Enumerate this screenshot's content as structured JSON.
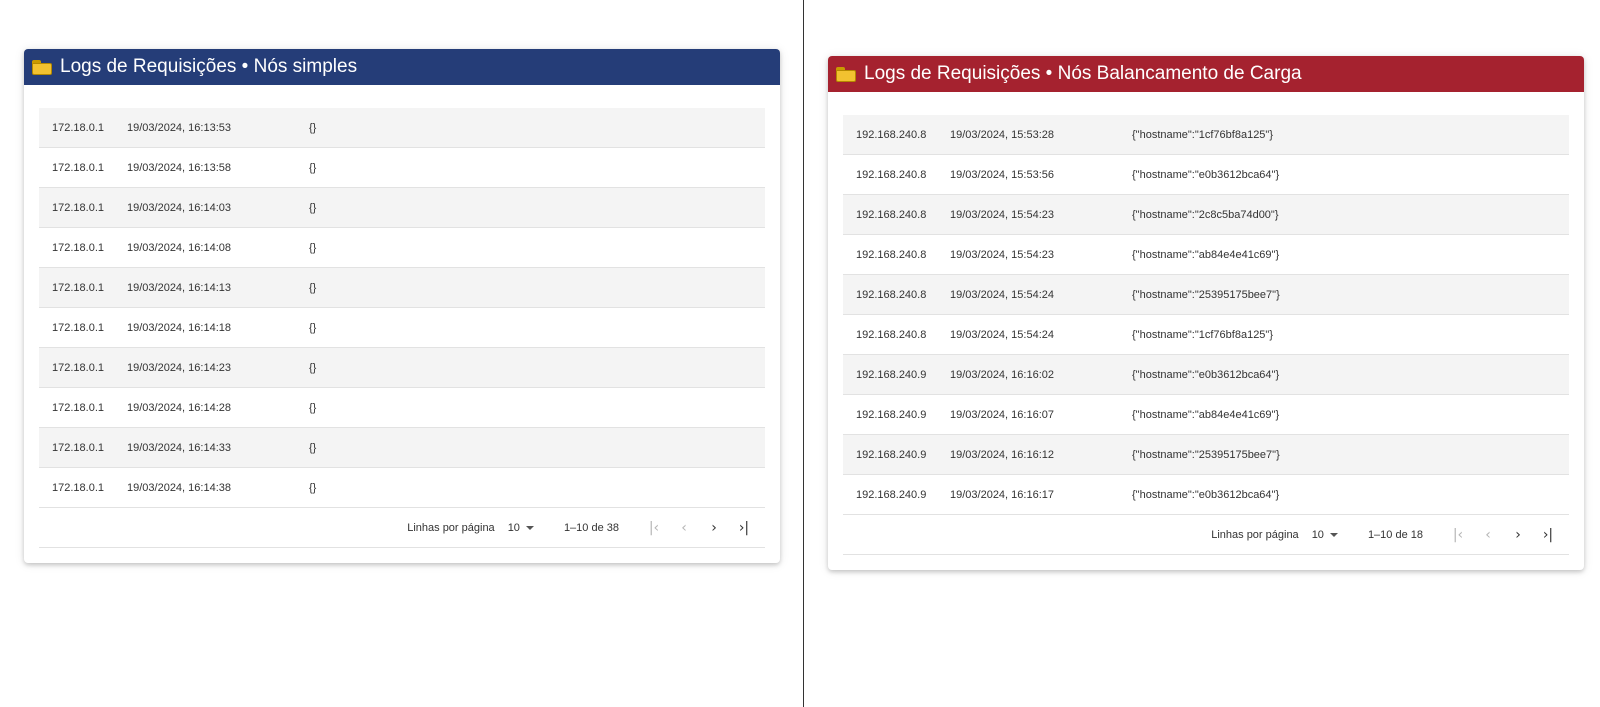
{
  "left_panel": {
    "title": "Logs de Requisições • Nós simples",
    "header_color": "#253d78",
    "rows": [
      {
        "ip": "172.18.0.1",
        "date": "19/03/2024, 16:13:53",
        "data": "{}"
      },
      {
        "ip": "172.18.0.1",
        "date": "19/03/2024, 16:13:58",
        "data": "{}"
      },
      {
        "ip": "172.18.0.1",
        "date": "19/03/2024, 16:14:03",
        "data": "{}"
      },
      {
        "ip": "172.18.0.1",
        "date": "19/03/2024, 16:14:08",
        "data": "{}"
      },
      {
        "ip": "172.18.0.1",
        "date": "19/03/2024, 16:14:13",
        "data": "{}"
      },
      {
        "ip": "172.18.0.1",
        "date": "19/03/2024, 16:14:18",
        "data": "{}"
      },
      {
        "ip": "172.18.0.1",
        "date": "19/03/2024, 16:14:23",
        "data": "{}"
      },
      {
        "ip": "172.18.0.1",
        "date": "19/03/2024, 16:14:28",
        "data": "{}"
      },
      {
        "ip": "172.18.0.1",
        "date": "19/03/2024, 16:14:33",
        "data": "{}"
      },
      {
        "ip": "172.18.0.1",
        "date": "19/03/2024, 16:14:38",
        "data": "{}"
      }
    ],
    "pagination": {
      "rows_per_page_label": "Linhas por página",
      "rows_per_page": "10",
      "range": "1–10 de 38"
    }
  },
  "right_panel": {
    "title": "Logs de Requisições • Nós Balancamento de Carga",
    "header_color": "#a5222f",
    "rows": [
      {
        "ip": "192.168.240.8",
        "date": "19/03/2024, 15:53:28",
        "data": "{\"hostname\":\"1cf76bf8a125\"}"
      },
      {
        "ip": "192.168.240.8",
        "date": "19/03/2024, 15:53:56",
        "data": "{\"hostname\":\"e0b3612bca64\"}"
      },
      {
        "ip": "192.168.240.8",
        "date": "19/03/2024, 15:54:23",
        "data": "{\"hostname\":\"2c8c5ba74d00\"}"
      },
      {
        "ip": "192.168.240.8",
        "date": "19/03/2024, 15:54:23",
        "data": "{\"hostname\":\"ab84e4e41c69\"}"
      },
      {
        "ip": "192.168.240.8",
        "date": "19/03/2024, 15:54:24",
        "data": "{\"hostname\":\"25395175bee7\"}"
      },
      {
        "ip": "192.168.240.8",
        "date": "19/03/2024, 15:54:24",
        "data": "{\"hostname\":\"1cf76bf8a125\"}"
      },
      {
        "ip": "192.168.240.9",
        "date": "19/03/2024, 16:16:02",
        "data": "{\"hostname\":\"e0b3612bca64\"}"
      },
      {
        "ip": "192.168.240.9",
        "date": "19/03/2024, 16:16:07",
        "data": "{\"hostname\":\"ab84e4e41c69\"}"
      },
      {
        "ip": "192.168.240.9",
        "date": "19/03/2024, 16:16:12",
        "data": "{\"hostname\":\"25395175bee7\"}"
      },
      {
        "ip": "192.168.240.9",
        "date": "19/03/2024, 16:16:17",
        "data": "{\"hostname\":\"e0b3612bca64\"}"
      }
    ],
    "pagination": {
      "rows_per_page_label": "Linhas por página",
      "rows_per_page": "10",
      "range": "1–10 de 18"
    }
  },
  "icons": {
    "header": "folder-icon",
    "first_page": "first-page-icon",
    "prev_page": "chevron-left-icon",
    "next_page": "chevron-right-icon",
    "last_page": "last-page-icon"
  }
}
